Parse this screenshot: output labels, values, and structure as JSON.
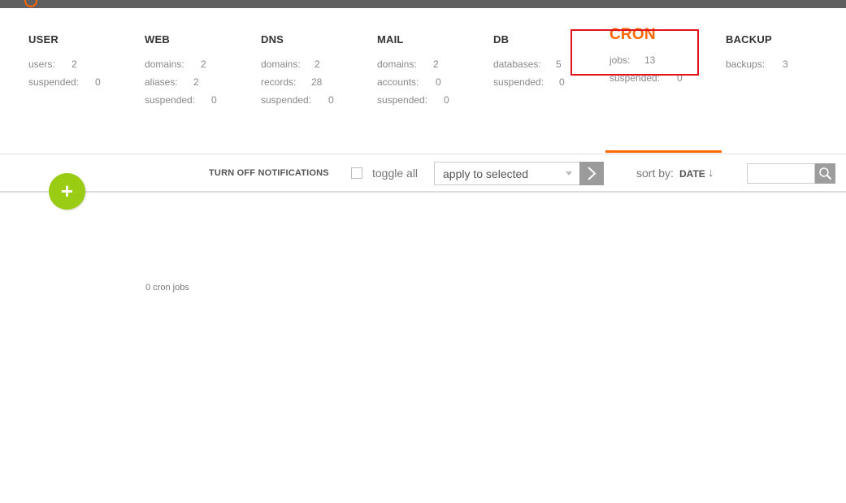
{
  "stats": [
    {
      "title": "USER",
      "rows": [
        {
          "label": "users:",
          "value": "2"
        },
        {
          "label": "suspended:",
          "value": "0"
        }
      ]
    },
    {
      "title": "WEB",
      "rows": [
        {
          "label": "domains:",
          "value": "2"
        },
        {
          "label": "aliases:",
          "value": "2"
        },
        {
          "label": "suspended:",
          "value": "0"
        }
      ]
    },
    {
      "title": "DNS",
      "rows": [
        {
          "label": "domains:",
          "value": "2"
        },
        {
          "label": "records:",
          "value": "28"
        },
        {
          "label": "suspended:",
          "value": "0"
        }
      ]
    },
    {
      "title": "MAIL",
      "rows": [
        {
          "label": "domains:",
          "value": "2"
        },
        {
          "label": "accounts:",
          "value": "0"
        },
        {
          "label": "suspended:",
          "value": "0"
        }
      ]
    },
    {
      "title": "DB",
      "rows": [
        {
          "label": "databases:",
          "value": "5"
        },
        {
          "label": "suspended:",
          "value": "0"
        }
      ]
    },
    {
      "title": "CRON",
      "rows": [
        {
          "label": "jobs:",
          "value": "13"
        },
        {
          "label": "suspended:",
          "value": "0"
        }
      ]
    },
    {
      "title": "BACKUP",
      "rows": [
        {
          "label": "backups:",
          "value": "3"
        }
      ]
    }
  ],
  "toolbar": {
    "notifications": "TURN OFF NOTIFICATIONS",
    "toggle_all": "toggle all",
    "apply_selected": "apply to selected",
    "sort_label": "sort by:",
    "sort_value": "DATE",
    "sort_arrow": "↓"
  },
  "add_button": {
    "symbol": "+"
  },
  "listing": {
    "count_label": "0 cron jobs"
  },
  "colors": {
    "accent": "#ff6701",
    "add_button": "#9acc14",
    "highlight": "#e0141a"
  }
}
